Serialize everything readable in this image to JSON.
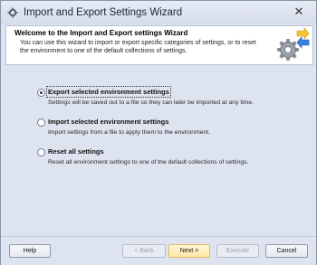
{
  "window": {
    "title": "Import and Export Settings Wizard",
    "close_glyph": "✕"
  },
  "header": {
    "title": "Welcome to the Import and Export settings Wizard",
    "description": "You can use this wizard to import or export specific categories of settings, or to reset the environment to one of the default collections of settings."
  },
  "options": [
    {
      "label": "Export selected environment settings",
      "description": "Settings will be saved out to a file so they can later be imported at any time.",
      "selected": true
    },
    {
      "label": "Import selected environment settings",
      "description": "Import settings from a file to apply them to the environment.",
      "selected": false
    },
    {
      "label": "Reset all settings",
      "description": "Reset all environment settings to one of the default collections of settings.",
      "selected": false
    }
  ],
  "footer": {
    "help_label": "Help",
    "back_label": "< Back",
    "next_label": "Next >",
    "execute_label": "Execute",
    "cancel_label": "Cancel"
  },
  "colors": {
    "accent_yellow": "#f5c431",
    "accent_blue": "#3b7fd8",
    "gear_gray": "#8a8f98"
  }
}
